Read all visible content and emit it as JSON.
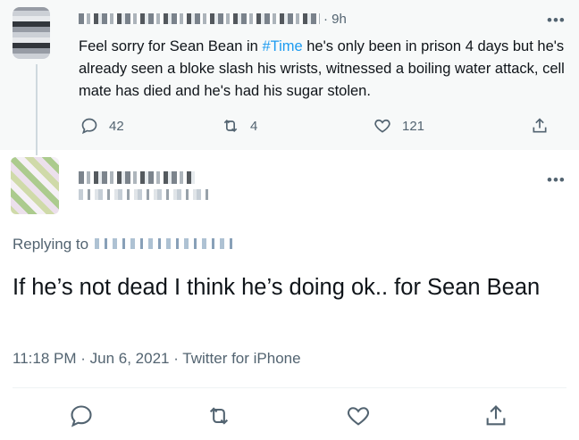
{
  "parent_tweet": {
    "time_sep": "· 9h",
    "text_before": "Feel sorry for Sean Bean in ",
    "hashtag": "#Time",
    "text_after": " he's only been in prison 4 days but he's already seen a bloke slash his wrists, witnessed a boiling water attack, cell mate has died and he's had his sugar stolen.",
    "replies": "42",
    "retweets": "4",
    "likes": "121"
  },
  "reply_tweet": {
    "replying_to": "Replying to",
    "text": "If he’s not dead I think he’s doing ok.. for Sean Bean",
    "time": "11:18 PM",
    "date": "Jun 6, 2021",
    "source": "Twitter for iPhone",
    "time_date_sep": " · ",
    "date_source_sep": " · "
  },
  "more_glyph": "•••",
  "colors": {
    "accent": "#1d9bf0",
    "muted": "#536471",
    "text": "#0f1419",
    "parent_bg": "#f7f9f9"
  }
}
